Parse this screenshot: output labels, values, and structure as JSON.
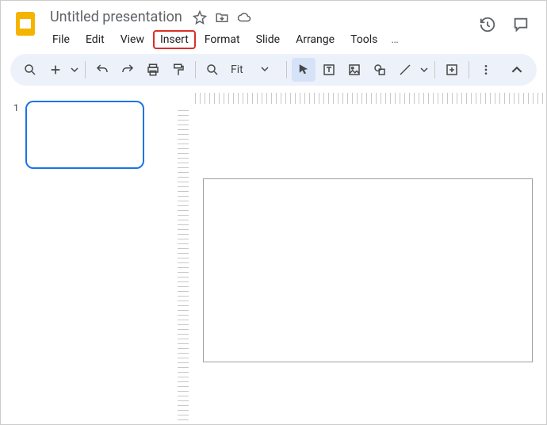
{
  "header": {
    "title": "Untitled presentation",
    "menus": [
      "File",
      "Edit",
      "View",
      "Insert",
      "Format",
      "Slide",
      "Arrange",
      "Tools"
    ],
    "highlighted_menu_index": 3,
    "more": "…"
  },
  "toolbar": {
    "zoom_label": "Fit"
  },
  "filmstrip": {
    "slides": [
      {
        "number": "1"
      }
    ]
  }
}
